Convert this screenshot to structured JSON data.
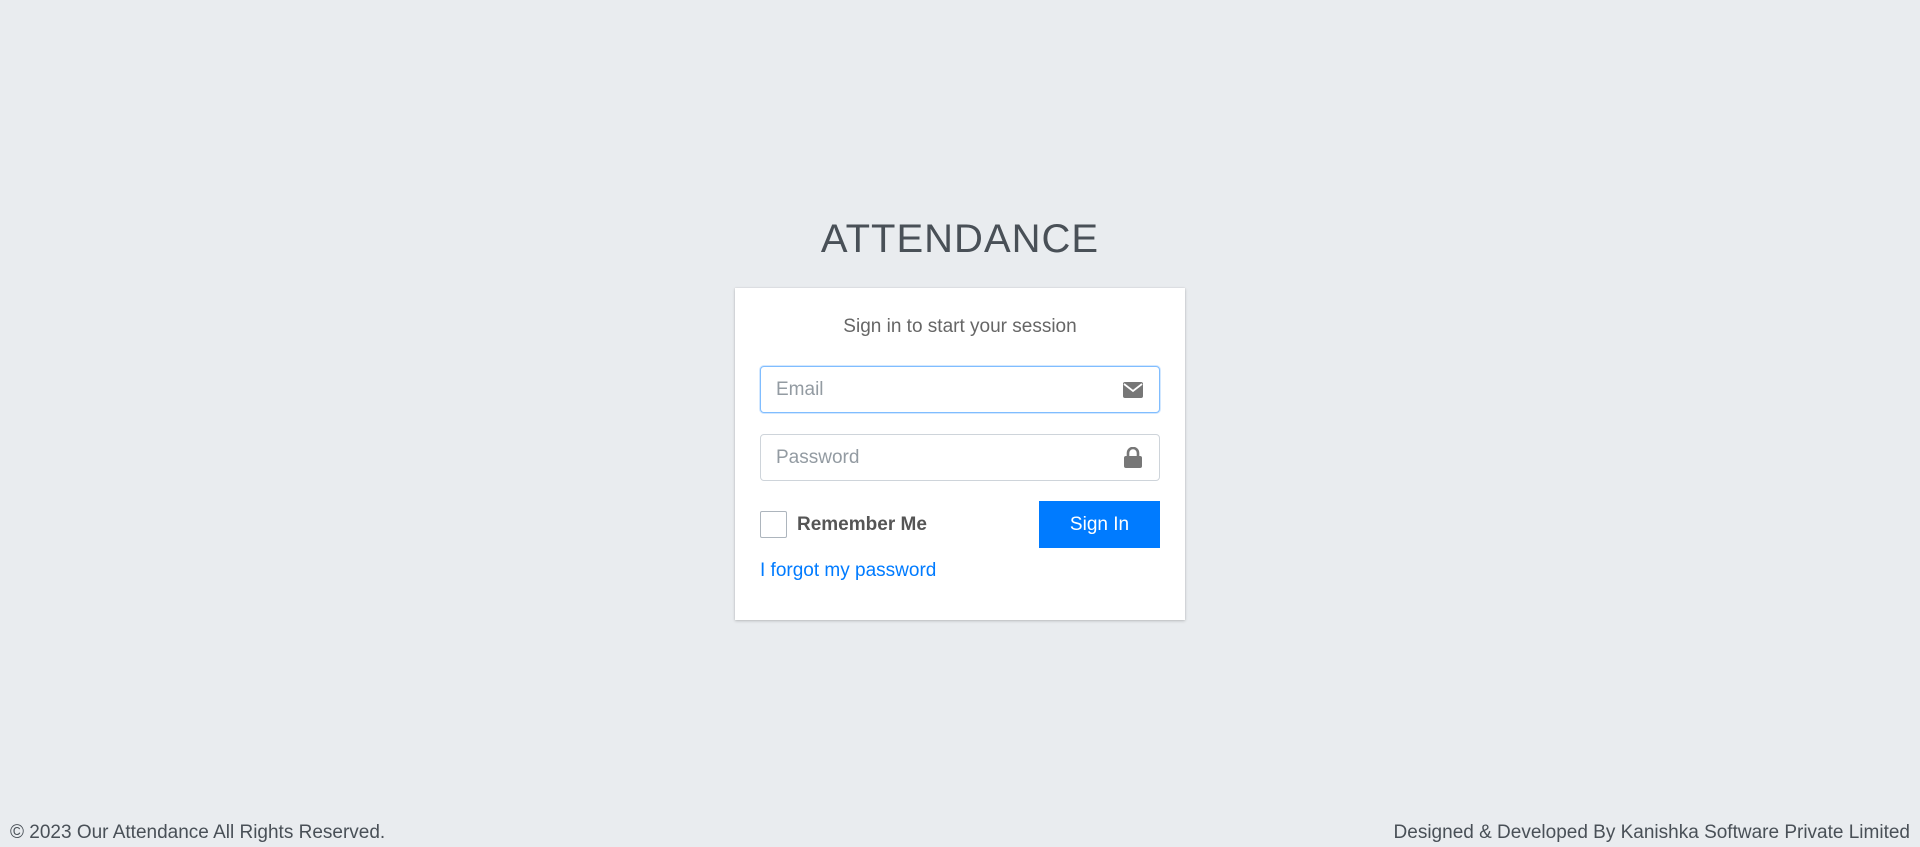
{
  "brand": {
    "title": "ATTENDANCE"
  },
  "login": {
    "message": "Sign in to start your session",
    "email": {
      "placeholder": "Email",
      "value": "",
      "icon": "envelope-icon"
    },
    "password": {
      "placeholder": "Password",
      "value": "",
      "icon": "lock-icon"
    },
    "remember_label": "Remember Me",
    "remember_checked": false,
    "signin_label": "Sign In",
    "forgot_label": "I forgot my password"
  },
  "footer": {
    "copyright": "© 2023 Our Attendance All Rights Reserved.",
    "credit": "Designed & Developed By Kanishka Software Private Limited"
  },
  "colors": {
    "background": "#e9ecef",
    "accent": "#007bff",
    "focus_border": "#80bdff"
  }
}
